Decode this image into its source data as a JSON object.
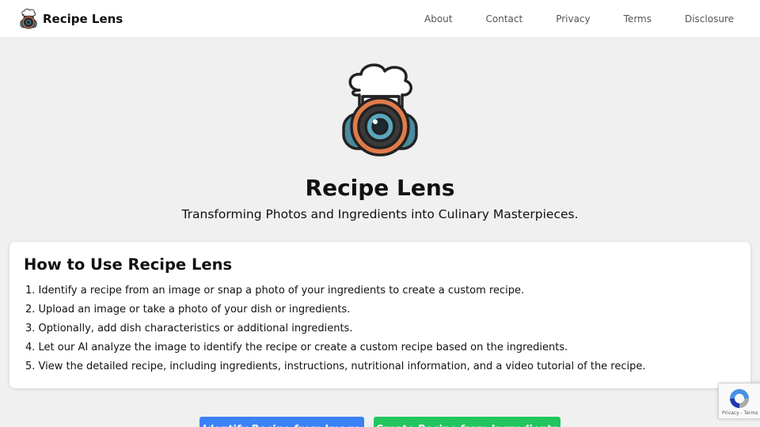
{
  "navbar": {
    "brand": "Recipe Lens",
    "links": [
      "About",
      "Contact",
      "Privacy",
      "Terms",
      "Disclosure"
    ]
  },
  "hero": {
    "title": "Recipe Lens",
    "subtitle": "Transforming Photos and Ingredients into Culinary Masterpieces."
  },
  "how_to": {
    "title": "How to Use Recipe Lens",
    "steps": [
      "1. Identify a recipe from an image or snap a photo of your ingredients to create a custom recipe.",
      "2. Upload an image or take a photo of your dish or ingredients.",
      "3. Optionally, add dish characteristics or additional ingredients.",
      "4. Let our AI analyze the image to identify the recipe or create a custom recipe based on the ingredients.",
      "5. View the detailed recipe, including ingredients, instructions, nutritional information, and a video tutorial of the recipe."
    ]
  },
  "actions": {
    "identify_label": "Identify Recipe from Image",
    "create_label": "Create Recipe from Ingredients"
  },
  "recaptcha": {
    "links": "Privacy - Terms"
  },
  "colors": {
    "background": "#f0f0f0",
    "navbar": "#ffffff",
    "identify_button": "#3b82f6",
    "create_button": "#22c55e",
    "logo_orange": "#e07b4a",
    "logo_teal": "#4a8a9c"
  },
  "icons": {
    "brand_logo": "chef-camera-icon",
    "hero_logo": "chef-camera-icon",
    "recaptcha": "recaptcha-icon"
  }
}
